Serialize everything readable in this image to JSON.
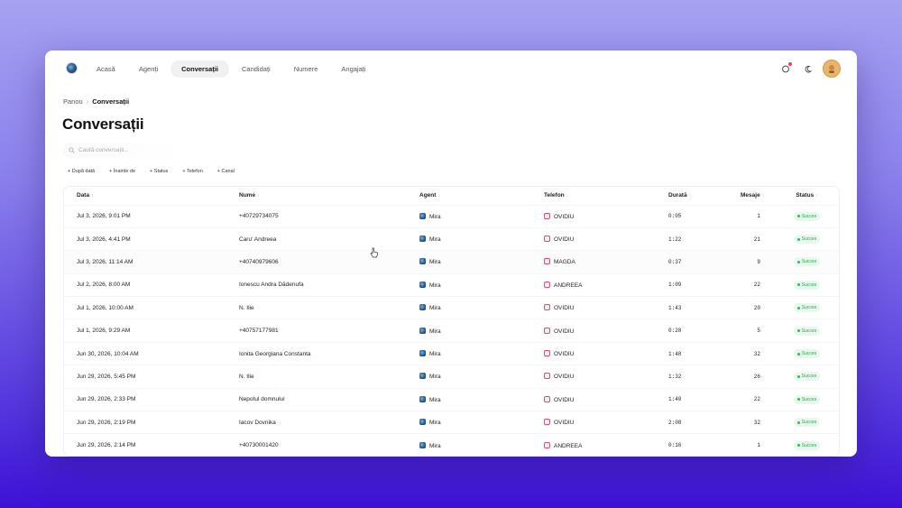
{
  "nav": {
    "items": [
      "Acasă",
      "Agenți",
      "Conversații",
      "Candidați",
      "Numere",
      "Angajați"
    ],
    "active_index": 2
  },
  "breadcrumb": {
    "root": "Panou",
    "separator": "›",
    "current": "Conversații"
  },
  "page": {
    "title": "Conversații"
  },
  "search": {
    "placeholder": "Caută conversații..."
  },
  "filters": [
    "+ După dată",
    "+ Înainte de",
    "+ Status",
    "+ Telefon",
    "+ Canal"
  ],
  "table": {
    "headers": {
      "date": "Data",
      "name": "Nume",
      "agent": "Agent",
      "phone": "Telefon",
      "duration": "Durată",
      "messages": "Mesaje",
      "status": "Status"
    },
    "sort_indicator": "↕",
    "rows": [
      {
        "date": "Jul 3, 2026, 9:01 PM",
        "name": "+40729734075",
        "agent": "Mira",
        "phone": "OVIDIU",
        "duration": "0:05",
        "messages": "1",
        "status": "Succes"
      },
      {
        "date": "Jul 3, 2026, 4:41 PM",
        "name": "Caru' Andreea",
        "agent": "Mira",
        "phone": "OVIDIU",
        "duration": "1:22",
        "messages": "21",
        "status": "Succes"
      },
      {
        "date": "Jul 3, 2026, 11:14 AM",
        "name": "+40740979606",
        "agent": "Mira",
        "phone": "MAGDA",
        "duration": "0:37",
        "messages": "9",
        "status": "Succes"
      },
      {
        "date": "Jul 2, 2026, 8:00 AM",
        "name": "Ionescu Andra Dădenufa",
        "agent": "Mira",
        "phone": "ANDREEA",
        "duration": "1:09",
        "messages": "22",
        "status": "Succes"
      },
      {
        "date": "Jul 1, 2026, 10:00 AM",
        "name": "N. Ilie",
        "agent": "Mira",
        "phone": "OVIDIU",
        "duration": "1:43",
        "messages": "20",
        "status": "Succes"
      },
      {
        "date": "Jul 1, 2026, 9:29 AM",
        "name": "+40757177981",
        "agent": "Mira",
        "phone": "OVIDIU",
        "duration": "0:28",
        "messages": "5",
        "status": "Succes"
      },
      {
        "date": "Jun 30, 2026, 10:04 AM",
        "name": "Ionita Georgiana Constanta",
        "agent": "Mira",
        "phone": "OVIDIU",
        "duration": "1:48",
        "messages": "32",
        "status": "Succes"
      },
      {
        "date": "Jun 29, 2026, 5:45 PM",
        "name": "N. Ilie",
        "agent": "Mira",
        "phone": "OVIDIU",
        "duration": "1:32",
        "messages": "26",
        "status": "Succes"
      },
      {
        "date": "Jun 29, 2026, 2:33 PM",
        "name": "Nepotul domnului",
        "agent": "Mira",
        "phone": "OVIDIU",
        "duration": "1:40",
        "messages": "22",
        "status": "Succes"
      },
      {
        "date": "Jun 29, 2026, 2:19 PM",
        "name": "Iacov Dovnika",
        "agent": "Mira",
        "phone": "OVIDIU",
        "duration": "2:08",
        "messages": "32",
        "status": "Succes"
      },
      {
        "date": "Jun 29, 2026, 2:14 PM",
        "name": "+40730001420",
        "agent": "Mira",
        "phone": "ANDREEA",
        "duration": "0:16",
        "messages": "1",
        "status": "Succes"
      }
    ]
  },
  "colors": {
    "accent_bg_top": "#a6a2f2",
    "accent_bg_bottom": "#3d12d6",
    "success": "#2f9e52",
    "phone_icon": "#e0487a"
  },
  "icons": {
    "logo": "brand-logo-icon",
    "notifications": "bell-icon",
    "theme": "moon-icon",
    "search": "search-icon",
    "agent": "agent-avatar-icon",
    "phone": "phone-channel-icon"
  }
}
